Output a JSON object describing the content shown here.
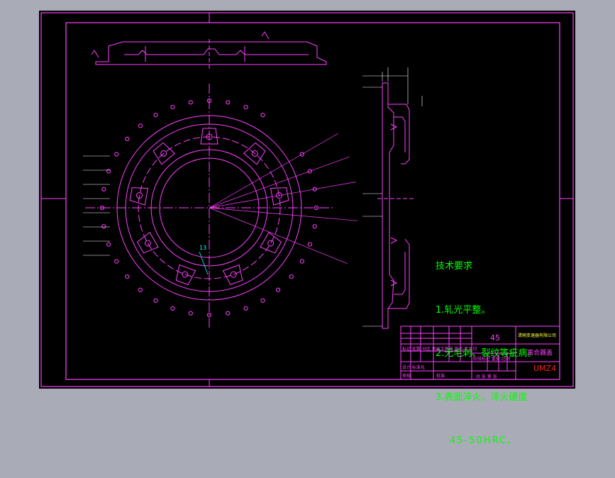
{
  "drawing": {
    "tech_requirements": {
      "title": "技术要求",
      "items": [
        "1.轧光平整。",
        "2.无毛刺、裂纹等疵病。",
        "3.表面淬火，淬火硬度",
        "45-50HRC。"
      ]
    },
    "title_block": {
      "material": "45",
      "company": "清翔变速器有限公司",
      "part_name": "离合器盖",
      "part_code": "UMZ4",
      "header_row": "标记 处数 分区 更改文件号 签名 年月日",
      "designer_row": "设计 标准化",
      "stage_row": "阶段标记 重量 比例",
      "review_row": "审核",
      "process_row": "工艺",
      "approve_row": "批准",
      "sheet_row": "共 张 第 张"
    },
    "leader_label": "13"
  },
  "colors": {
    "frame": "#ff40ff",
    "text_green": "#00ff00",
    "dim": "#ffffff",
    "center": "#ff40ff",
    "title_red": "#ff2020"
  }
}
